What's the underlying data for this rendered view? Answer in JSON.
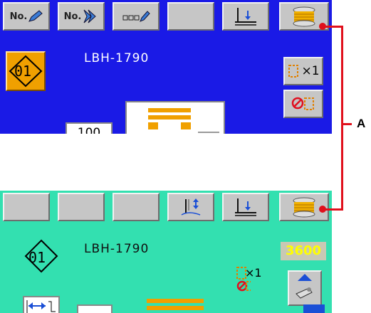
{
  "top": {
    "toolbar": {
      "buttons": [
        {
          "label": "No.",
          "icon": "pattern-no-edit-icon"
        },
        {
          "label": "No.",
          "icon": "pattern-no-select-icon"
        },
        {
          "label": "",
          "icon": "name-edit-icon"
        },
        {
          "label": "",
          "icon": "blank"
        },
        {
          "label": "",
          "icon": "presser-down-icon"
        },
        {
          "label": "",
          "icon": "bobbin-winder-icon"
        }
      ]
    },
    "pattern_no": "01",
    "model": "LBH-1790",
    "side_buttons": [
      {
        "label": "×1",
        "icon": "counter-x1-icon"
      },
      {
        "label": "",
        "icon": "counter-off-icon"
      }
    ],
    "partial_label": "100"
  },
  "bottom": {
    "toolbar": {
      "buttons": [
        {
          "label": "",
          "icon": "blank"
        },
        {
          "label": "",
          "icon": "blank"
        },
        {
          "label": "",
          "icon": "blank"
        },
        {
          "label": "",
          "icon": "thread-clamp-icon"
        },
        {
          "label": "",
          "icon": "presser-down-icon"
        },
        {
          "label": "",
          "icon": "bobbin-winder-icon"
        }
      ]
    },
    "pattern_no": "01",
    "model": "LBH-1790",
    "counter_value": "3600",
    "counter_indicator": "×1"
  },
  "callout": {
    "label": "A"
  },
  "colors": {
    "top_bg": "#1a1ae6",
    "bottom_bg": "#33e0b0",
    "callout": "#e0101c",
    "accent_orange": "#f0a000"
  }
}
